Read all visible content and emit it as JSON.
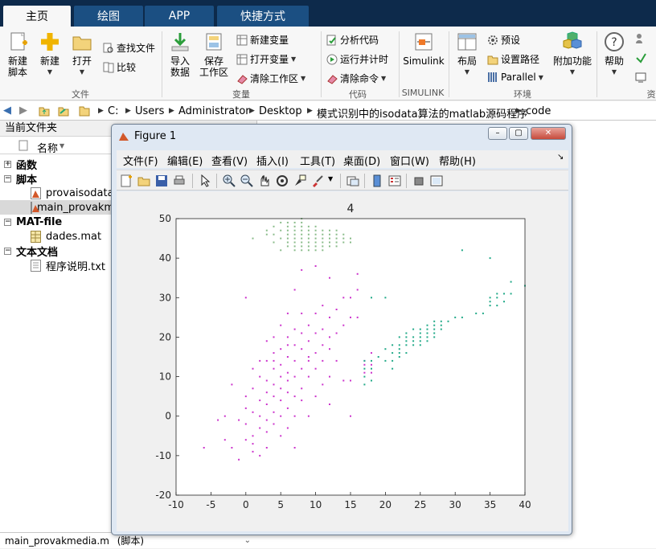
{
  "tabs": [
    {
      "label": "主页",
      "active": true
    },
    {
      "label": "绘图",
      "active": false
    },
    {
      "label": "APP",
      "active": false
    },
    {
      "label": "快捷方式",
      "active": false
    }
  ],
  "ribbon": {
    "new_script": "新建\n脚本",
    "new": "新建",
    "open": "打开",
    "find_files": "查找文件",
    "compare": "比较",
    "import_data": "导入\n数据",
    "save_workspace": "保存\n工作区",
    "new_variable": "新建变量",
    "open_variable": "打开变量",
    "clear_workspace": "清除工作区",
    "analyze_code": "分析代码",
    "run_and_time": "运行并计时",
    "clear_commands": "清除命令",
    "simulink": "Simulink",
    "layout": "布局",
    "preferences": "预设",
    "set_path": "设置路径",
    "parallel": "Parallel",
    "addons": "附加功能",
    "help": "帮助",
    "groups": {
      "file": "文件",
      "variable": "变量",
      "code": "代码",
      "simulink": "SIMULINK",
      "environment": "环境",
      "resources": "资"
    }
  },
  "address": {
    "crumbs": [
      "C:",
      "Users",
      "Administrator",
      "Desktop",
      "模式识别中的isodata算法的matlab源码程序",
      "code"
    ]
  },
  "current_folder": {
    "title": "当前文件夹",
    "column_name": "名称",
    "groups": [
      {
        "label": "函数",
        "expanded": false,
        "items": []
      },
      {
        "label": "脚本",
        "expanded": true,
        "items": [
          "provaisodata.m",
          "main_provakm"
        ]
      },
      {
        "label": "MAT-file",
        "expanded": true,
        "items": [
          "dades.mat"
        ]
      },
      {
        "label": "文本文档",
        "expanded": true,
        "items": [
          "程序说明.txt"
        ]
      }
    ],
    "status_file": "main_provakmedia.m",
    "status_type": "(脚本)"
  },
  "figure": {
    "title": "Figure 1",
    "menus": [
      "文件(F)",
      "编辑(E)",
      "查看(V)",
      "插入(I)",
      "工具(T)",
      "桌面(D)",
      "窗口(W)",
      "帮助(H)"
    ],
    "toolbar_icons": [
      "new-figure-icon",
      "open-file-icon",
      "save-icon",
      "print-icon",
      "pointer-icon",
      "zoom-in-icon",
      "zoom-out-icon",
      "pan-icon",
      "rotate-icon",
      "data-cursor-icon",
      "brush-icon",
      "link-plot-icon",
      "colorbar-icon",
      "legend-icon",
      "hide-plot-tools-icon",
      "show-plot-tools-icon"
    ]
  },
  "colors": {
    "tabbar_bg": "#0d2a4b",
    "tab_inactive": "#1b4f82",
    "cluster_magenta": "#cc33cc",
    "cluster_teal": "#22aa88",
    "cluster_green": "#88bb88"
  },
  "chart_data": {
    "type": "scatter",
    "title": "4",
    "xlim": [
      -10,
      40
    ],
    "ylim": [
      -20,
      50
    ],
    "xticks": [
      "-10",
      "-5",
      "0",
      "5",
      "10",
      "15",
      "20",
      "25",
      "30",
      "35",
      "40"
    ],
    "yticks": [
      "-20",
      "-10",
      "0",
      "10",
      "20",
      "30",
      "40",
      "50"
    ],
    "grid": false,
    "series": [
      {
        "color": "#cc33cc",
        "points": [
          [
            -6,
            -8
          ],
          [
            -4,
            -1
          ],
          [
            -3,
            0
          ],
          [
            -2,
            -8
          ],
          [
            -2,
            8
          ],
          [
            -1,
            -1
          ],
          [
            -1,
            -11
          ],
          [
            0,
            -2
          ],
          [
            0,
            5
          ],
          [
            0,
            2
          ],
          [
            0,
            -6
          ],
          [
            1,
            -5
          ],
          [
            1,
            12
          ],
          [
            1,
            -9
          ],
          [
            1,
            1
          ],
          [
            1,
            7
          ],
          [
            2,
            4
          ],
          [
            2,
            0
          ],
          [
            2,
            -3
          ],
          [
            2,
            10
          ],
          [
            2,
            14
          ],
          [
            2,
            -10
          ],
          [
            3,
            3
          ],
          [
            3,
            9
          ],
          [
            3,
            -1
          ],
          [
            3,
            6
          ],
          [
            3,
            14
          ],
          [
            3,
            -4
          ],
          [
            3,
            19
          ],
          [
            4,
            5
          ],
          [
            4,
            12
          ],
          [
            4,
            1
          ],
          [
            4,
            16
          ],
          [
            4,
            -2
          ],
          [
            4,
            8
          ],
          [
            4,
            20
          ],
          [
            5,
            10
          ],
          [
            5,
            4
          ],
          [
            5,
            17
          ],
          [
            5,
            0
          ],
          [
            5,
            13
          ],
          [
            5,
            7
          ],
          [
            5,
            -5
          ],
          [
            5,
            23
          ],
          [
            6,
            11
          ],
          [
            6,
            6
          ],
          [
            6,
            15
          ],
          [
            6,
            2
          ],
          [
            6,
            20
          ],
          [
            6,
            9
          ],
          [
            6,
            -3
          ],
          [
            6,
            26
          ],
          [
            7,
            14
          ],
          [
            7,
            10
          ],
          [
            7,
            5
          ],
          [
            7,
            18
          ],
          [
            7,
            22
          ],
          [
            7,
            0
          ],
          [
            7,
            -8
          ],
          [
            7,
            32
          ],
          [
            8,
            17
          ],
          [
            8,
            12
          ],
          [
            8,
            7
          ],
          [
            8,
            21
          ],
          [
            8,
            26
          ],
          [
            8,
            4
          ],
          [
            8,
            37
          ],
          [
            9,
            14
          ],
          [
            9,
            19
          ],
          [
            9,
            10
          ],
          [
            9,
            23
          ],
          [
            9,
            0
          ],
          [
            9,
            15
          ],
          [
            10,
            16
          ],
          [
            10,
            21
          ],
          [
            10,
            12
          ],
          [
            10,
            5
          ],
          [
            10,
            26
          ],
          [
            10,
            38
          ],
          [
            11,
            18
          ],
          [
            11,
            22
          ],
          [
            11,
            14
          ],
          [
            11,
            8
          ],
          [
            11,
            28
          ],
          [
            12,
            17
          ],
          [
            12,
            20
          ],
          [
            12,
            25
          ],
          [
            12,
            10
          ],
          [
            12,
            3
          ],
          [
            12,
            35
          ],
          [
            13,
            21
          ],
          [
            13,
            27
          ],
          [
            13,
            14
          ],
          [
            14,
            23
          ],
          [
            14,
            30
          ],
          [
            14,
            9
          ],
          [
            15,
            25
          ],
          [
            15,
            9
          ],
          [
            15,
            0
          ],
          [
            15,
            30
          ],
          [
            16,
            25
          ],
          [
            16,
            32
          ],
          [
            16,
            36
          ],
          [
            17,
            14
          ],
          [
            17,
            11
          ],
          [
            17,
            13
          ],
          [
            18,
            11
          ],
          [
            18,
            16
          ],
          [
            18,
            13
          ],
          [
            0,
            30
          ],
          [
            3,
            -8
          ],
          [
            -3,
            -6
          ],
          [
            1,
            -7
          ],
          [
            4,
            14
          ],
          [
            6,
            18
          ]
        ]
      },
      {
        "color": "#22aa88",
        "points": [
          [
            17,
            8
          ],
          [
            17,
            10
          ],
          [
            17,
            12
          ],
          [
            17,
            14
          ],
          [
            18,
            9
          ],
          [
            18,
            12
          ],
          [
            18,
            14
          ],
          [
            18,
            30
          ],
          [
            20,
            14
          ],
          [
            20,
            17
          ],
          [
            20,
            30
          ],
          [
            21,
            12
          ],
          [
            21,
            14
          ],
          [
            21,
            16
          ],
          [
            21,
            18
          ],
          [
            22,
            15
          ],
          [
            22,
            16
          ],
          [
            22,
            17
          ],
          [
            22,
            18
          ],
          [
            22,
            20
          ],
          [
            23,
            16
          ],
          [
            23,
            18
          ],
          [
            23,
            19
          ],
          [
            23,
            21
          ],
          [
            24,
            18
          ],
          [
            24,
            19
          ],
          [
            24,
            20
          ],
          [
            24,
            22
          ],
          [
            25,
            18
          ],
          [
            25,
            19
          ],
          [
            25,
            20
          ],
          [
            25,
            21
          ],
          [
            25,
            22
          ],
          [
            26,
            19
          ],
          [
            26,
            20
          ],
          [
            26,
            21
          ],
          [
            26,
            22
          ],
          [
            26,
            23
          ],
          [
            27,
            20
          ],
          [
            27,
            21
          ],
          [
            27,
            22
          ],
          [
            27,
            23
          ],
          [
            27,
            24
          ],
          [
            28,
            22
          ],
          [
            28,
            23
          ],
          [
            28,
            24
          ],
          [
            29,
            24
          ],
          [
            30,
            25
          ],
          [
            31,
            25
          ],
          [
            31,
            42
          ],
          [
            33,
            26
          ],
          [
            34,
            26
          ],
          [
            35,
            28
          ],
          [
            35,
            29
          ],
          [
            35,
            30
          ],
          [
            36,
            28
          ],
          [
            36,
            30
          ],
          [
            36,
            31
          ],
          [
            37,
            29
          ],
          [
            37,
            31
          ],
          [
            38,
            31
          ],
          [
            38,
            34
          ],
          [
            40,
            33
          ],
          [
            35,
            40
          ],
          [
            19,
            15
          ],
          [
            23,
            20
          ]
        ]
      },
      {
        "color": "#88bb88",
        "points": [
          [
            1,
            45
          ],
          [
            3,
            46
          ],
          [
            3,
            47
          ],
          [
            4,
            44
          ],
          [
            4,
            46
          ],
          [
            4,
            48
          ],
          [
            5,
            42
          ],
          [
            5,
            45
          ],
          [
            5,
            47
          ],
          [
            5,
            49
          ],
          [
            6,
            43
          ],
          [
            6,
            44
          ],
          [
            6,
            45
          ],
          [
            6,
            46
          ],
          [
            6,
            47
          ],
          [
            6,
            48
          ],
          [
            7,
            42
          ],
          [
            7,
            43
          ],
          [
            7,
            44
          ],
          [
            7,
            45
          ],
          [
            7,
            46
          ],
          [
            7,
            47
          ],
          [
            7,
            48
          ],
          [
            7,
            49
          ],
          [
            8,
            42
          ],
          [
            8,
            43
          ],
          [
            8,
            44
          ],
          [
            8,
            45
          ],
          [
            8,
            46
          ],
          [
            8,
            47
          ],
          [
            8,
            48
          ],
          [
            8,
            49
          ],
          [
            9,
            42
          ],
          [
            9,
            43
          ],
          [
            9,
            44
          ],
          [
            9,
            45
          ],
          [
            9,
            46
          ],
          [
            9,
            47
          ],
          [
            9,
            48
          ],
          [
            10,
            42
          ],
          [
            10,
            43
          ],
          [
            10,
            44
          ],
          [
            10,
            45
          ],
          [
            10,
            46
          ],
          [
            10,
            47
          ],
          [
            10,
            48
          ],
          [
            11,
            42
          ],
          [
            11,
            43
          ],
          [
            11,
            44
          ],
          [
            11,
            45
          ],
          [
            11,
            46
          ],
          [
            11,
            47
          ],
          [
            12,
            43
          ],
          [
            12,
            44
          ],
          [
            12,
            45
          ],
          [
            12,
            46
          ],
          [
            12,
            47
          ],
          [
            13,
            43
          ],
          [
            13,
            44
          ],
          [
            13,
            45
          ],
          [
            13,
            46
          ],
          [
            14,
            44
          ],
          [
            14,
            45
          ],
          [
            14,
            46
          ],
          [
            15,
            44
          ],
          [
            15,
            45
          ],
          [
            6,
            49
          ],
          [
            8,
            50
          ],
          [
            13,
            47
          ]
        ]
      }
    ]
  }
}
